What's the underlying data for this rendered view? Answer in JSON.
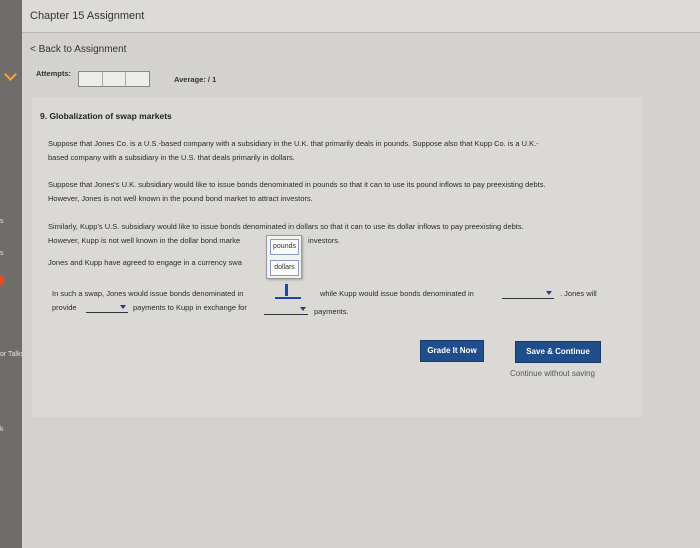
{
  "header": {
    "assignment_title": "Chapter 15 Assignment"
  },
  "sidebar": {
    "labels": [
      "s",
      "s",
      "or Talks",
      "k"
    ]
  },
  "nav": {
    "back_link": "< Back to Assignment"
  },
  "status": {
    "attempts_label": "Attempts:",
    "average_label": "Average: / 1"
  },
  "question": {
    "title": "9. Globalization of swap markets",
    "para1_line1": "Suppose that Jones Co. is a U.S.-based company with a subsidiary in the U.K. that primarily deals in pounds. Suppose also that Kupp Co. is a U.K.-",
    "para1_line2": "based company with a subsidiary in the U.S. that deals primarily in dollars.",
    "para2_line1": "Suppose that Jones's U.K. subsidiary would like to issue bonds denominated in pounds so that it can to use its pound inflows to pay preexisting debts.",
    "para2_line2": "However, Jones is not well known in the pound bond market to attract investors.",
    "para3_line1": "Similarly, Kupp's U.S. subsidiary would like to issue bonds denominated in dollars so that it can to use its dollar inflows to pay preexisting debts.",
    "para3_line2a": "However, Kupp is not well known in the dollar bond marke",
    "para3_line2b": "investors.",
    "para4_line1": "Jones and Kupp have agreed to engage in a currency swa",
    "para5_line1a": "In such a swap, Jones would issue bonds denominated in",
    "para5_line1b": "while Kupp would issue bonds denominated in",
    "para5_line1c": ". Jones will",
    "para5_line2a": "provide",
    "para5_line2b": "payments to Kupp in exchange for",
    "para5_line2c": "payments."
  },
  "dropdown_popup": {
    "options": [
      "pounds",
      "dollars"
    ]
  },
  "actions": {
    "grade_label": "Grade It Now",
    "save_label": "Save & Continue",
    "continue_label": "Continue without saving"
  }
}
